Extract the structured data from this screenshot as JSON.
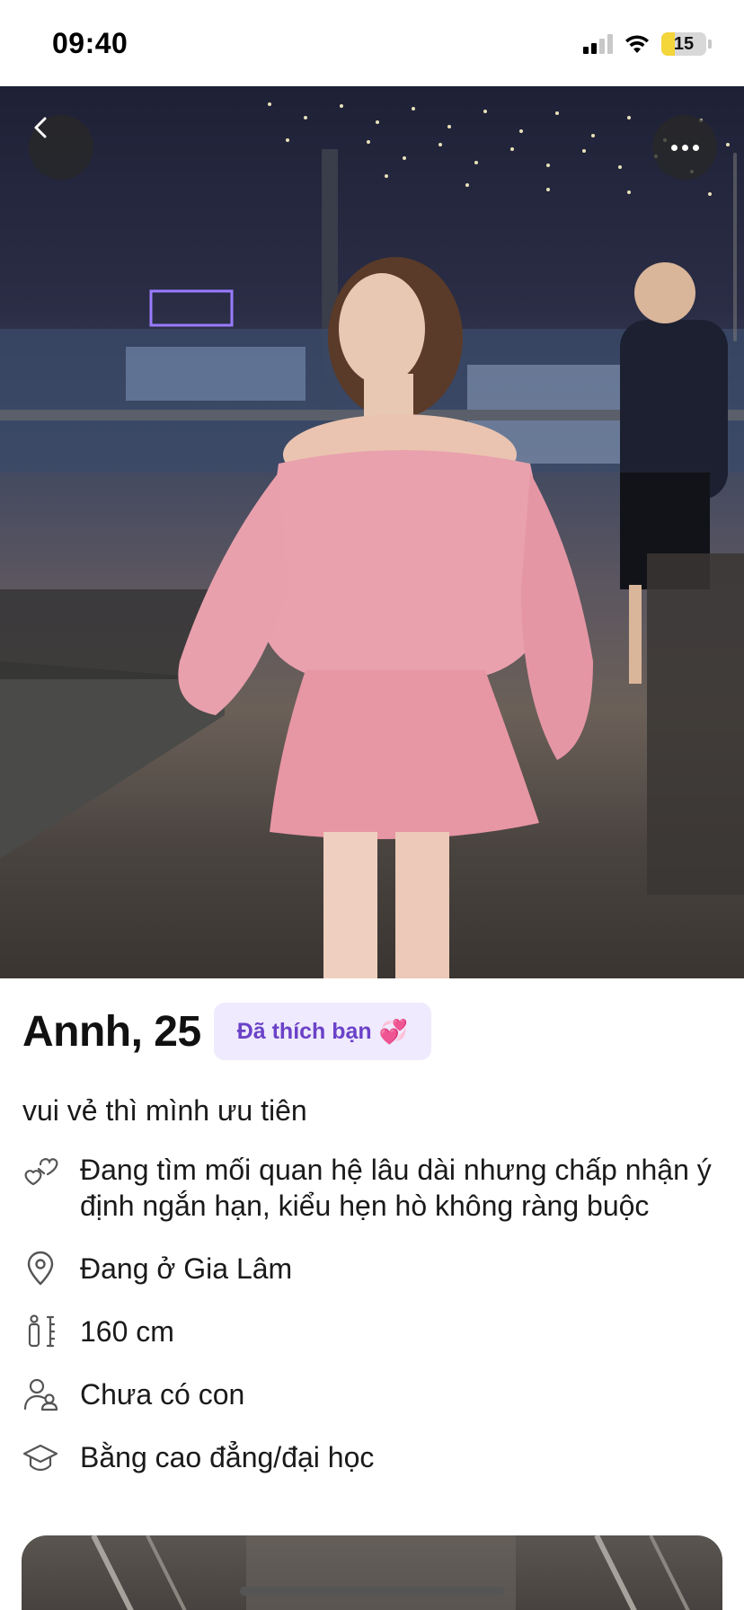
{
  "status_bar": {
    "time": "09:40",
    "battery_level": "15",
    "icons": [
      "cellular-signal-icon",
      "wifi-icon",
      "battery-icon"
    ]
  },
  "photo": {
    "back_icon": "chevron-left-icon",
    "more_icon": "ellipsis-icon"
  },
  "profile": {
    "name_age": "Annh, 25",
    "liked_badge": "Đã thích bạn",
    "liked_emoji": "💞",
    "bio": "vui vẻ thì mình ưu tiên",
    "details": [
      {
        "icon": "hearts-icon",
        "text": "Đang tìm mối quan hệ lâu dài nhưng chấp nhận ý định ngắn hạn, kiểu hẹn hò không ràng buộc"
      },
      {
        "icon": "location-pin-icon",
        "text": "Đang ở Gia Lâm"
      },
      {
        "icon": "height-icon",
        "text": "160 cm"
      },
      {
        "icon": "children-icon",
        "text": "Chưa có con"
      },
      {
        "icon": "graduation-cap-icon",
        "text": "Bằng cao đẳng/đại học"
      }
    ]
  },
  "colors": {
    "badge_bg": "#efeafd",
    "badge_text": "#6b42c8",
    "battery_fill": "#f4d53a"
  }
}
